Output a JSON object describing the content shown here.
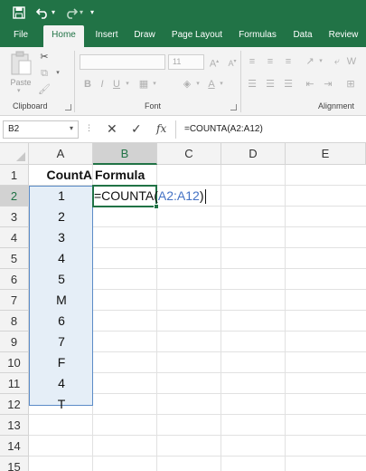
{
  "tabs": [
    "File",
    "Home",
    "Insert",
    "Draw",
    "Page Layout",
    "Formulas",
    "Data",
    "Review"
  ],
  "active_tab": "Home",
  "ribbon": {
    "paste_label": "Paste",
    "font_size": "11",
    "groups": [
      "Clipboard",
      "Font",
      "Alignment"
    ]
  },
  "formula_bar": {
    "name_box": "B2",
    "fx_label": "fx",
    "formula": "=COUNTA(A2:A12)"
  },
  "grid": {
    "columns": [
      "A",
      "B",
      "C",
      "D",
      "E"
    ],
    "rows": [
      "1",
      "2",
      "3",
      "4",
      "5",
      "6",
      "7",
      "8",
      "9",
      "10",
      "11",
      "12",
      "13",
      "14",
      "15"
    ],
    "header_a": "CountA",
    "header_b": "Formula",
    "values_a": [
      "1",
      "2",
      "3",
      "4",
      "5",
      "M",
      "6",
      "7",
      "F",
      "4",
      "T"
    ],
    "editing_b2_prefix": "=COUNTA(",
    "editing_b2_ref": "A2:A12",
    "editing_b2_suffix": ")"
  },
  "colors": {
    "excel_green": "#217346",
    "ref_blue": "#4472c4"
  }
}
